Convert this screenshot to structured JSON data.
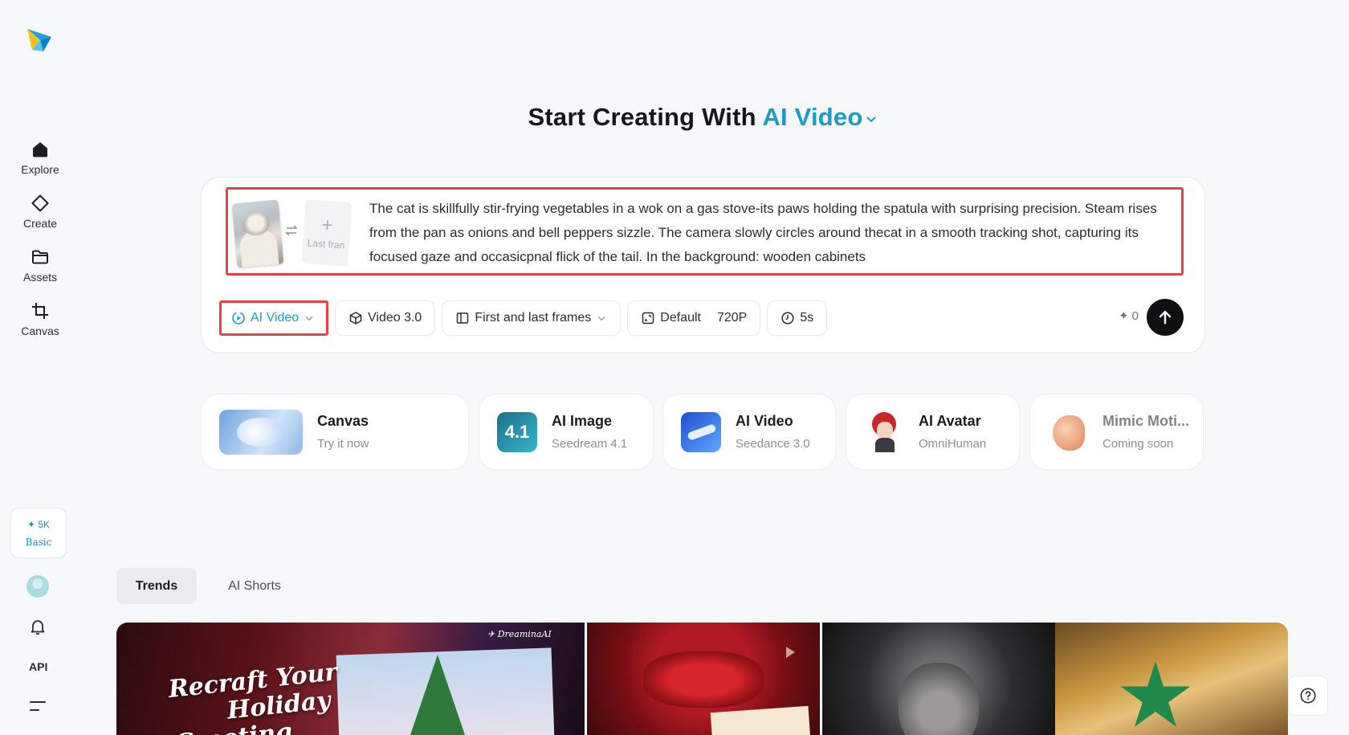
{
  "sidebar": {
    "logo": "dreamina-logo-icon",
    "items": [
      {
        "label": "Explore",
        "icon": "home-icon"
      },
      {
        "label": "Create",
        "icon": "diamond-icon"
      },
      {
        "label": "Assets",
        "icon": "folder-icon"
      },
      {
        "label": "Canvas",
        "icon": "crop-icon"
      }
    ],
    "credits": {
      "amount": "5K",
      "plan": "Basic"
    },
    "api_label": "API"
  },
  "heading": {
    "prefix": "Start Creating With",
    "accent": "AI Video"
  },
  "prompt": {
    "first_frame": "cat-thumbnail",
    "last_frame_label": "Last fran",
    "text": "The cat is skillfully stir-frying vegetables in a wok on a gas stove-its paws holding the spatula with surprising precision. Steam rises from the pan as onions and bell peppers sizzle. The camera slowly circles around thecat in a smooth tracking shot, capturing its focused gaze and occasicpnal flick of the tail. In the background: wooden cabinets"
  },
  "toolbar": {
    "type_label": "AI Video",
    "model_label": "Video 3.0",
    "frames_label": "First and last frames",
    "ratio_label": "Default",
    "resolution_label": "720P",
    "duration_label": "5s",
    "credits_cost": "0"
  },
  "tools": [
    {
      "title": "Canvas",
      "subtitle": "Try it now"
    },
    {
      "title": "AI Image",
      "subtitle": "Seedream 4.1",
      "badge": "4.1"
    },
    {
      "title": "AI Video",
      "subtitle": "Seedance 3.0"
    },
    {
      "title": "AI Avatar",
      "subtitle": "OmniHuman"
    },
    {
      "title": "Mimic Moti...",
      "subtitle": "Coming soon"
    }
  ],
  "tabs": [
    {
      "label": "Trends",
      "active": true
    },
    {
      "label": "AI Shorts",
      "active": false
    }
  ],
  "gallery": {
    "item1_text_line1": "Recraft Your",
    "item1_text_line2": "Holiday",
    "item1_text_line3": "Greeting",
    "item1_brand": "DreaminaAI"
  },
  "colors": {
    "accent": "#1a9cc4",
    "highlight_border": "#e04444",
    "send_button": "#0f1012"
  }
}
